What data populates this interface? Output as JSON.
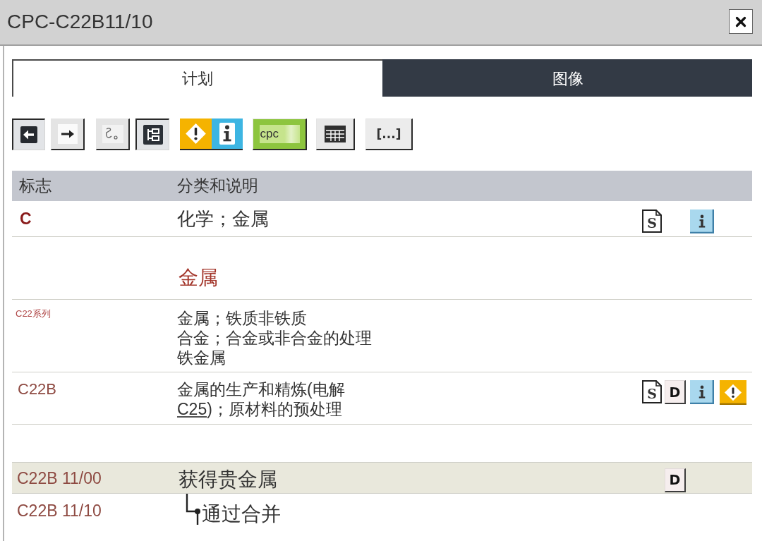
{
  "window": {
    "title": "CPC-C22B11/10"
  },
  "tabs": [
    {
      "label": "计划",
      "selected": true
    },
    {
      "label": "图像",
      "selected": false
    }
  ],
  "toolbar": [
    {
      "kind": "back",
      "pressed": true
    },
    {
      "kind": "forward",
      "pressed": false
    },
    {
      "kind": "scribble",
      "pressed": false
    },
    {
      "kind": "tree",
      "pressed": true
    },
    {
      "kind": "warning_info",
      "pressed": false
    },
    {
      "kind": "cpc",
      "label": "cpc",
      "pressed": false
    },
    {
      "kind": "table",
      "pressed": false
    },
    {
      "kind": "ellipsis",
      "label": "[...]",
      "pressed": false
    }
  ],
  "table": {
    "columns": [
      "标志",
      "分类和说明"
    ],
    "rows": [
      {
        "kind": "section",
        "symbol": "C",
        "highlighted": false,
        "lines": [
          {
            "text": "化学；金属"
          }
        ],
        "icons": [
          {
            "kind": "page",
            "glyph": "S"
          },
          {
            "kind": "info"
          }
        ]
      },
      {
        "kind": "title",
        "highlighted": false,
        "lines": [
          {
            "text": "金属"
          }
        ]
      },
      {
        "kind": "class",
        "symbol": "C22系列",
        "highlighted": false,
        "lines": [
          {
            "text": "金属；铁质非铁质"
          },
          {
            "text": "合金；合金或非合金的处理"
          },
          {
            "text": "铁金属"
          }
        ]
      },
      {
        "kind": "subclass",
        "symbol": "C22B",
        "highlighted": false,
        "lines": [
          {
            "text": "金属的生产和精炼(电解",
            "link": "C25",
            "text_after": ")；原材料的预处理"
          }
        ],
        "icons": [
          {
            "kind": "page",
            "glyph": "S"
          },
          {
            "kind": "tile",
            "glyph": "D"
          },
          {
            "kind": "info"
          },
          {
            "kind": "warning"
          }
        ]
      },
      {
        "kind": "main_group",
        "symbol": "C22B 11/00",
        "highlighted": true,
        "lines": [
          {
            "text": "获得贵金属"
          }
        ],
        "icons": [
          {
            "kind": "tile",
            "glyph": "D"
          }
        ]
      },
      {
        "kind": "subgroup",
        "symbol": "C22B 11/10",
        "highlighted": false,
        "lines": [
          {
            "text": "通过合并"
          }
        ]
      }
    ]
  }
}
